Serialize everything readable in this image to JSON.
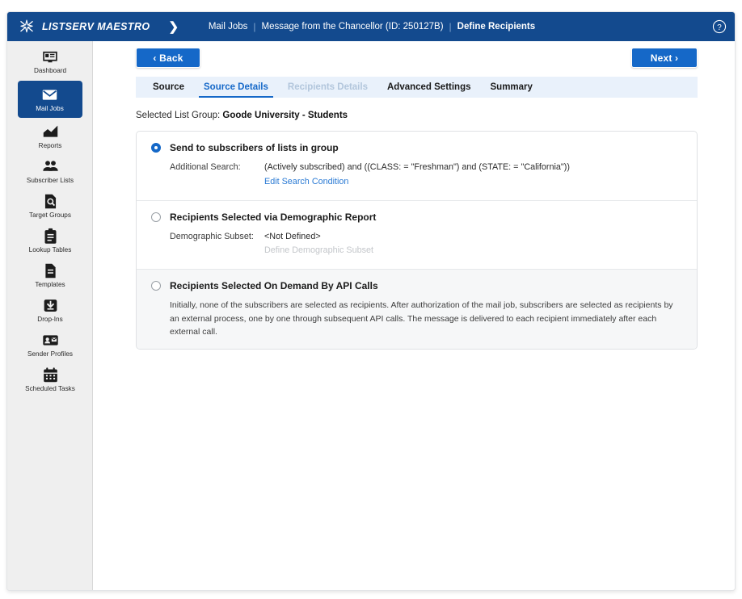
{
  "header": {
    "brand": "LISTSERV MAESTRO",
    "brand_chevron": "❯",
    "breadcrumb": [
      {
        "label": "Mail Jobs",
        "current": false
      },
      {
        "label": "Message from the Chancellor (ID: 250127B)",
        "current": false
      },
      {
        "label": "Define Recipients",
        "current": true
      }
    ],
    "separator": "|",
    "help_icon": "help-circle-icon"
  },
  "sidebar": {
    "items": [
      {
        "label": "Dashboard",
        "icon": "dashboard-icon",
        "selected": false
      },
      {
        "label": "Mail Jobs",
        "icon": "envelope-icon",
        "selected": true
      },
      {
        "label": "Reports",
        "icon": "chart-icon",
        "selected": false
      },
      {
        "label": "Subscriber Lists",
        "icon": "people-icon",
        "selected": false
      },
      {
        "label": "Target Groups",
        "icon": "document-search-icon",
        "selected": false
      },
      {
        "label": "Lookup Tables",
        "icon": "clipboard-icon",
        "selected": false
      },
      {
        "label": "Templates",
        "icon": "file-lines-icon",
        "selected": false
      },
      {
        "label": "Drop-Ins",
        "icon": "download-box-icon",
        "selected": false
      },
      {
        "label": "Sender Profiles",
        "icon": "id-card-icon",
        "selected": false
      },
      {
        "label": "Scheduled Tasks",
        "icon": "calendar-icon",
        "selected": false
      }
    ]
  },
  "toolbar": {
    "back_label": "‹ Back",
    "next_label": "Next ›"
  },
  "tabs": [
    {
      "label": "Source",
      "state": "normal"
    },
    {
      "label": "Source Details",
      "state": "active"
    },
    {
      "label": "Recipients Details",
      "state": "disabled"
    },
    {
      "label": "Advanced Settings",
      "state": "normal"
    },
    {
      "label": "Summary",
      "state": "normal"
    }
  ],
  "content": {
    "selected_list_group_label": "Selected List Group:",
    "selected_list_group_value": "Goode University - Students",
    "options": [
      {
        "title": "Send to subscribers of lists in group",
        "checked": true,
        "detail_label": "Additional Search:",
        "detail_value": "(Actively subscribed) and ((CLASS: = \"Freshman\") and (STATE: = \"California\"))",
        "link_label": "Edit Search Condition",
        "link_disabled": false
      },
      {
        "title": "Recipients Selected via Demographic Report",
        "checked": false,
        "detail_label": "Demographic Subset:",
        "detail_value": "<Not Defined>",
        "link_label": "Define Demographic Subset",
        "link_disabled": true
      },
      {
        "title": "Recipients Selected On Demand By API Calls",
        "checked": false,
        "description": "Initially, none of the subscribers are selected as recipients. After authorization of the mail job, subscribers are selected as recipients by an external process, one by one through subsequent API calls. The message is delivered to each recipient immediately after each external call."
      }
    ]
  },
  "colors": {
    "header_blue": "#134a8e",
    "accent_blue": "#1568c8",
    "link_blue": "#2a7ad4",
    "tab_band": "#e9f1fb",
    "sidebar_bg": "#efefef"
  }
}
